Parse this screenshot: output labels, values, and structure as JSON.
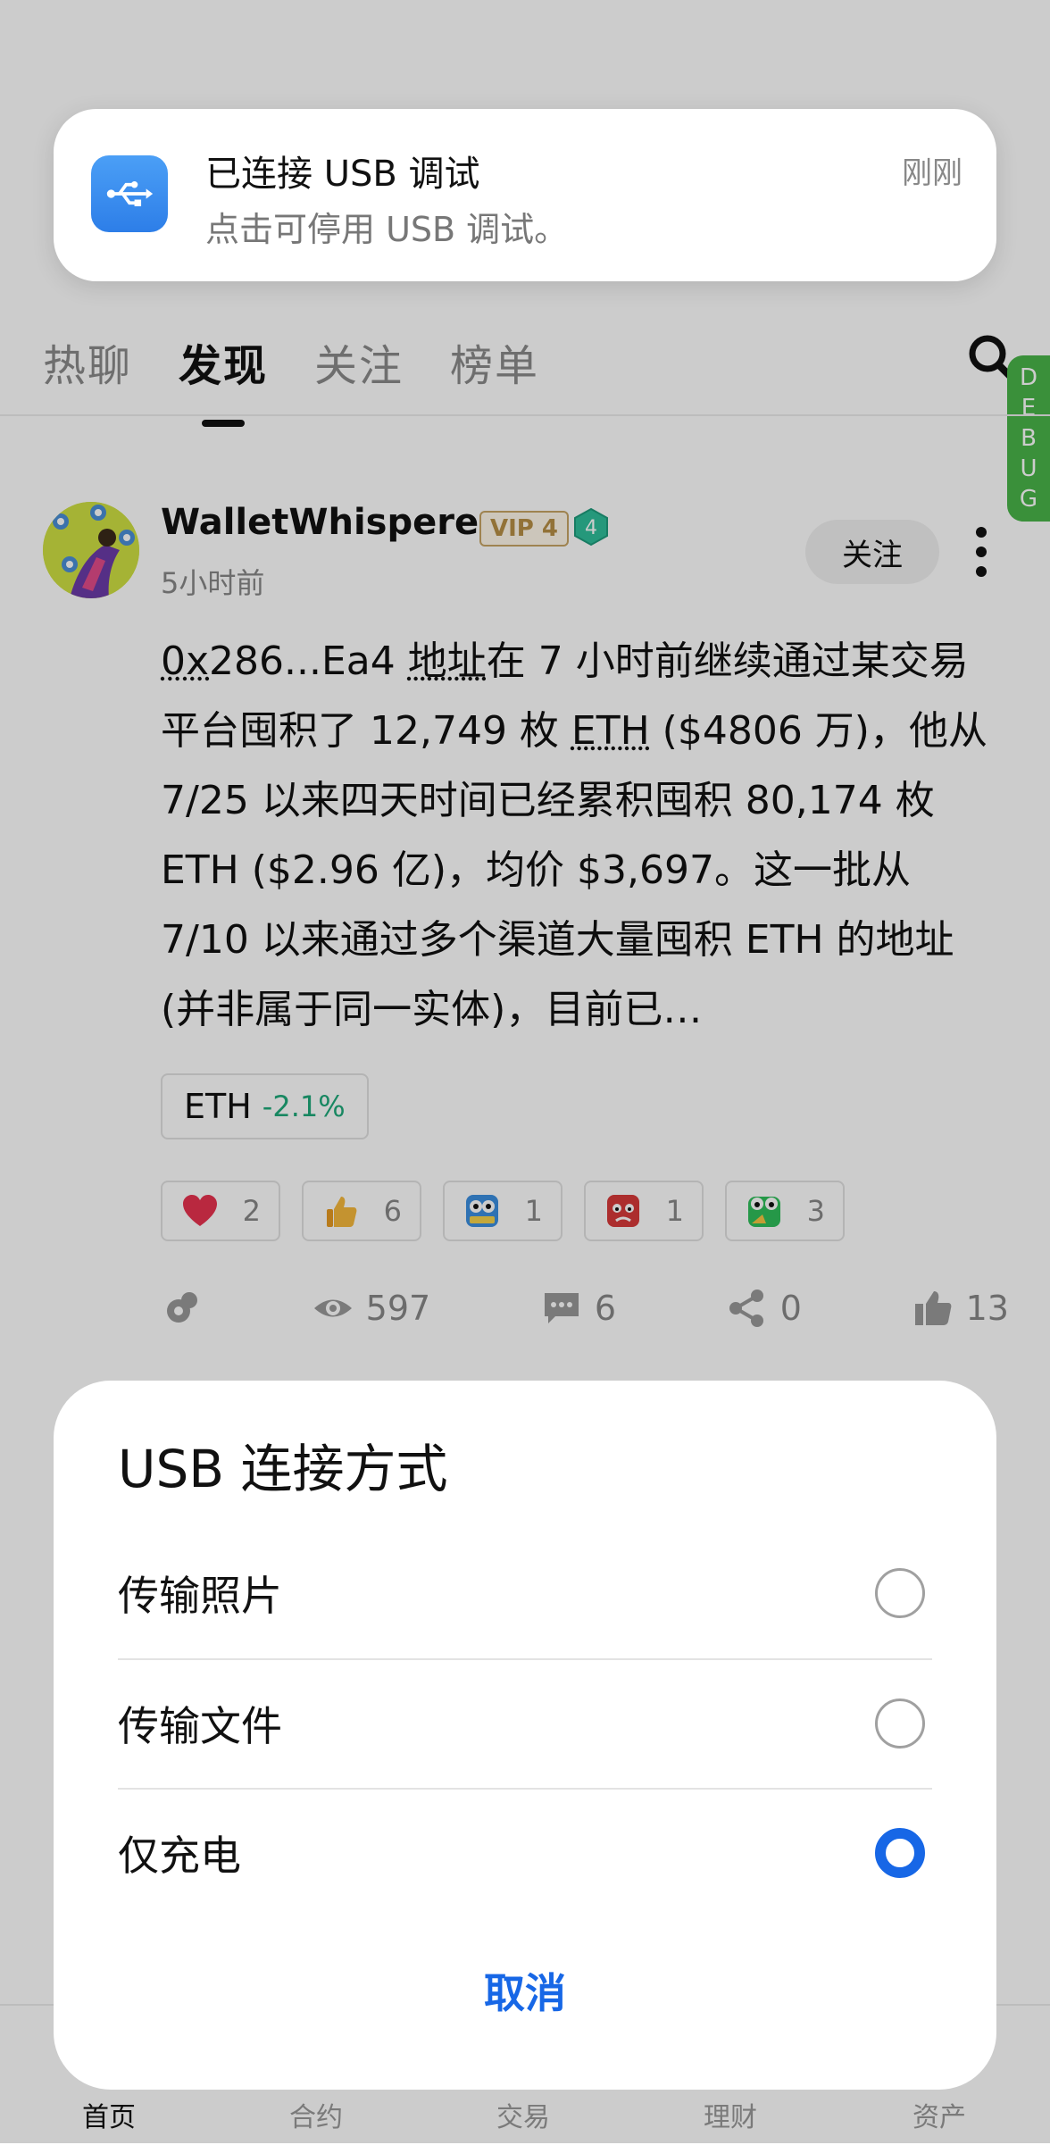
{
  "header": {
    "tabs": [
      {
        "label": "热聊"
      },
      {
        "label": "发现"
      },
      {
        "label": "关注"
      },
      {
        "label": "榜单"
      }
    ],
    "debug_label": [
      "D",
      "E",
      "B",
      "U",
      "G"
    ]
  },
  "post": {
    "username": "WalletWhisperer",
    "vip_label": "VIP 4",
    "level": "4",
    "time": "5小时前",
    "follow_label": "关注",
    "text_parts": {
      "p1": "0x",
      "p2": "286...Ea4 ",
      "p3": "地址",
      "p4": "在 7 小时前继续通过某交易平台囤积了 12,749 枚 ",
      "p5": "ETH",
      "p6": " ($4806 万)，他从 7/25 以来四天时间已经累积囤积 80,174 枚 ETH ($2.96 亿)，均价 $3,697。这一批从 7/10 以来通过多个渠道大量囤积 ETH 的地址 (并非属于同一实体)，目前已…"
    },
    "coin_tag": {
      "symbol": "ETH",
      "change": "-2.1%"
    },
    "reactions": [
      {
        "icon": "heart-icon",
        "count": "2"
      },
      {
        "icon": "thumbs-up-emoji-icon",
        "count": "6"
      },
      {
        "icon": "hodl-owl-emoji-icon",
        "count": "1"
      },
      {
        "icon": "angry-face-emoji-icon",
        "count": "1"
      },
      {
        "icon": "green-frog-emoji-icon",
        "count": "3"
      }
    ],
    "stats": {
      "views": "597",
      "comments": "6",
      "shares": "0",
      "likes": "13"
    }
  },
  "bottom_nav": [
    {
      "label": "首页"
    },
    {
      "label": "合约"
    },
    {
      "label": "交易"
    },
    {
      "label": "理财"
    },
    {
      "label": "资产"
    }
  ],
  "notification": {
    "title": "已连接 USB 调试",
    "body": "点击可停用 USB 调试。",
    "time": "刚刚"
  },
  "usb_dialog": {
    "title": "USB 连接方式",
    "options": [
      {
        "label": "传输照片",
        "selected": false
      },
      {
        "label": "传输文件",
        "selected": false
      },
      {
        "label": "仅充电",
        "selected": true
      }
    ],
    "cancel_label": "取消"
  },
  "colors": {
    "accent_blue": "#1767e6",
    "debug_green": "#49b549",
    "price_down_green": "#1fa97a"
  }
}
